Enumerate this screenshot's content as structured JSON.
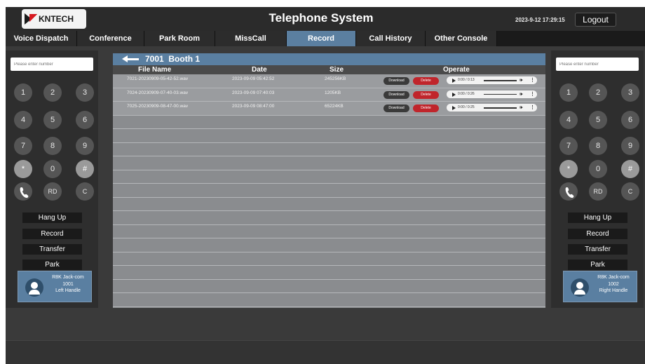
{
  "header": {
    "logo_text": "KNTECH",
    "title": "Telephone System",
    "datetime": "2023-9-12  17:29:15",
    "logout_label": "Logout"
  },
  "tabs": [
    {
      "label": "Voice Dispatch",
      "active": false
    },
    {
      "label": "Conference",
      "active": false
    },
    {
      "label": "Park Room",
      "active": false
    },
    {
      "label": "MissCall",
      "active": false
    },
    {
      "label": "Record",
      "active": true
    },
    {
      "label": "Call History",
      "active": false
    },
    {
      "label": "Other Console",
      "active": false
    }
  ],
  "left_panel": {
    "placeholder": "Please enter number",
    "keys": [
      "1",
      "2",
      "3",
      "4",
      "5",
      "6",
      "7",
      "8",
      "9",
      "*",
      "0",
      "#",
      "phone-icon",
      "RD",
      "C"
    ],
    "actions": [
      "Hang Up",
      "Record",
      "Transfer",
      "Park"
    ],
    "handle": {
      "name": "R8K Jack-com",
      "ext": "1001",
      "label": "Left Handle"
    }
  },
  "right_panel": {
    "placeholder": "Please enter number",
    "keys": [
      "1",
      "2",
      "3",
      "4",
      "5",
      "6",
      "7",
      "8",
      "9",
      "*",
      "0",
      "#",
      "phone-icon",
      "RD",
      "C"
    ],
    "actions": [
      "Hang Up",
      "Record",
      "Transfer",
      "Park"
    ],
    "handle": {
      "name": "R8K Jack-com",
      "ext": "1002",
      "label": "Right Handle"
    }
  },
  "records": {
    "header_ext": "7001",
    "header_booth": "Booth 1",
    "columns": {
      "file_name": "File Name",
      "date": "Date",
      "size": "Size",
      "operate": "Operate"
    },
    "download_label": "Download",
    "delete_label": "Delete",
    "rows": [
      {
        "file": "7021-20230909-05-42-52.wav",
        "date": "2023-09-09 05:42:52",
        "size": "245256KB",
        "time": "0:00 / 0:13"
      },
      {
        "file": "7024-20230909-07-40-03.wav",
        "date": "2023-09-09 07:40:03",
        "size": "1205KB",
        "time": "0:00 / 0:26"
      },
      {
        "file": "7025-20230909-08-47-00.wav",
        "date": "2023-09-09 08:47:00",
        "size": "65224KB",
        "time": "0:00 / 0:25"
      }
    ]
  },
  "colors": {
    "accent_blue": "#5a7fa1",
    "delete_red": "#c0252b",
    "dark_bg": "#3a3a3a"
  }
}
